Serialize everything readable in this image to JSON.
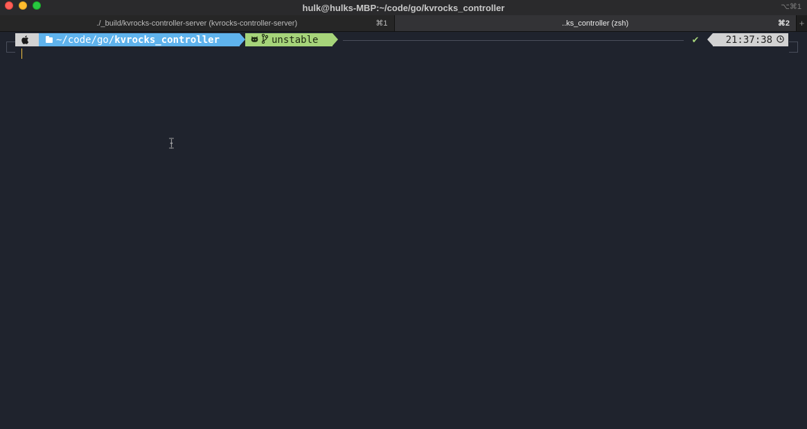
{
  "window": {
    "title": "hulk@hulks-MBP:~/code/go/kvrocks_controller",
    "shortcut": "⌥⌘1"
  },
  "tabs": [
    {
      "label": "./_build/kvrocks-controller-server (kvrocks-controller-server)",
      "shortcut": "⌘1",
      "active": false
    },
    {
      "label": "..ks_controller (zsh)",
      "shortcut": "⌘2",
      "active": true
    }
  ],
  "tab_add_label": "+",
  "prompt": {
    "os_icon": "apple-icon",
    "folder_icon": "folder-icon",
    "dir_base": "~/code/go/",
    "dir_leaf": "kvrocks_controller",
    "git_icon": "github-icon",
    "branch_icon": "git-branch-icon",
    "branch": "unstable",
    "status_mark": "✔",
    "time": "21:37:38",
    "clock_icon": "clock-icon"
  },
  "colors": {
    "background": "#1f232d",
    "dir_segment": "#5fb3ed",
    "git_segment": "#a6d47a",
    "os_segment": "#d2d2d2",
    "cursor": "#f5c542"
  }
}
